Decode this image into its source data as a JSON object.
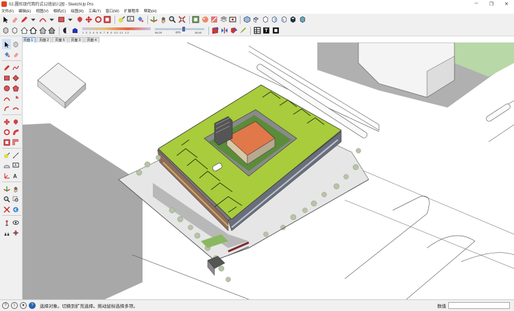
{
  "window": {
    "title": "02.圆形现代简约式12班幼儿园 - SketchUp Pro",
    "minimize": "─",
    "maximize": "❐",
    "close": "✕"
  },
  "menu": [
    {
      "label": "文件(F)"
    },
    {
      "label": "编辑(E)"
    },
    {
      "label": "视图(V)"
    },
    {
      "label": "相机(C)"
    },
    {
      "label": "绘图(R)"
    },
    {
      "label": "工具(T)"
    },
    {
      "label": "窗口(W)"
    },
    {
      "label": "扩展程序"
    },
    {
      "label": "帮助(H)"
    }
  ],
  "toolbar": {
    "shadow_ticks": "1 2 3 4 5 6 7 8 9 10 11 12",
    "time_start": "06:29",
    "time_mid": "中午",
    "time_end": "18:40"
  },
  "scene_tabs": [
    {
      "label": "页面 1",
      "active": true
    },
    {
      "label": "页面 2",
      "active": false
    },
    {
      "label": "页面 5",
      "active": false
    },
    {
      "label": "页面 3",
      "active": false
    },
    {
      "label": "页面 4",
      "active": false
    }
  ],
  "status": {
    "hint": "选择对象。切换到扩充选择。拖动鼠标选择多项。",
    "measure_label": "数值",
    "measure_value": ""
  },
  "colors": {
    "roof_green": "#a8cc3c",
    "roof_orange": "#e0784a",
    "shadow_gray": "#a8a8a8",
    "background_ground": "#ffffff",
    "accent_green_corner": "#b8d8a8"
  }
}
